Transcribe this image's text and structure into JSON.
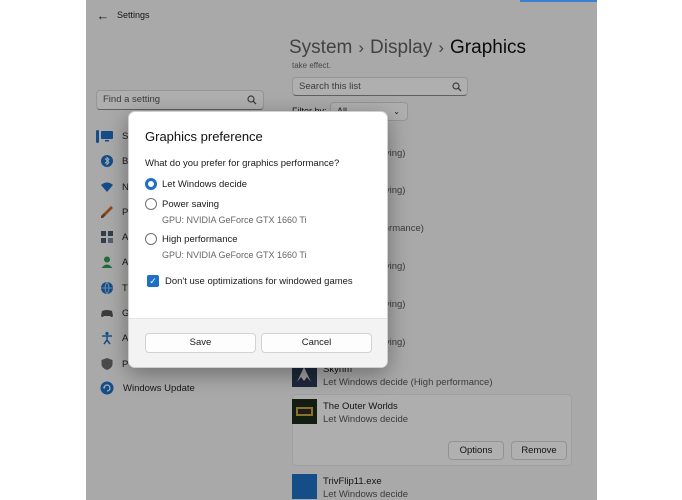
{
  "window": {
    "app_title": "Settings",
    "back_icon": "back-arrow-icon"
  },
  "sidebar": {
    "search_placeholder": "Find a setting",
    "search_icon": "search-icon",
    "items": [
      {
        "label": "Sy",
        "icon": "system-icon",
        "color": "#1f6fc4",
        "selected": true
      },
      {
        "label": "B",
        "icon": "bluetooth-icon",
        "color": "#1f6fc4"
      },
      {
        "label": "N",
        "icon": "network-icon",
        "color": "#1f6fc4"
      },
      {
        "label": "P",
        "icon": "personalization-brush-icon",
        "color": "#c96a2a"
      },
      {
        "label": "A",
        "icon": "apps-icon",
        "color": "#4b5a6b"
      },
      {
        "label": "A",
        "icon": "accounts-person-icon",
        "color": "#2e9a5a"
      },
      {
        "label": "Ti",
        "icon": "time-language-globe-icon",
        "color": "#1f6fc4"
      },
      {
        "label": "G",
        "icon": "gaming-controller-icon",
        "color": "#555555"
      },
      {
        "label": "A",
        "icon": "accessibility-icon",
        "color": "#1f6fc4"
      },
      {
        "label": "P",
        "icon": "privacy-shield-icon",
        "color": "#6b6b6b"
      }
    ],
    "windows_update": {
      "label": "Windows Update",
      "icon": "windows-update-icon"
    }
  },
  "breadcrumb": {
    "items": [
      "System",
      "Display"
    ],
    "current": "Graphics",
    "separator": "›"
  },
  "list": {
    "partial_text": "take effect.",
    "search_placeholder": "Search this list",
    "filter_label": "Filter by:",
    "filter_value": "All",
    "partial_statuses": [
      "cide (Power saving)",
      "cide (Power saving)",
      "cide (High performance)",
      "cide (Power saving)",
      "cide (Power saving)",
      "cide (Power saving)"
    ],
    "apps": [
      {
        "name": "Skyrim",
        "status": "Let Windows decide (High performance)",
        "icon": "skyrim-app-icon"
      },
      {
        "name": "The Outer Worlds",
        "status": "Let Windows decide",
        "icon": "outer-worlds-app-icon",
        "expanded": true
      },
      {
        "name": "TrivFlip11.exe",
        "status": "Let Windows decide",
        "icon": "trivflip-app-icon"
      }
    ],
    "options_label": "Options",
    "remove_label": "Remove"
  },
  "dialog": {
    "title": "Graphics preference",
    "question": "What do you prefer for graphics performance?",
    "options": [
      {
        "label": "Let Windows decide",
        "sub": "",
        "checked": true
      },
      {
        "label": "Power saving",
        "sub": "GPU: NVIDIA GeForce GTX 1660 Ti",
        "checked": false
      },
      {
        "label": "High performance",
        "sub": "GPU: NVIDIA GeForce GTX 1660 Ti",
        "checked": false
      }
    ],
    "checkbox_label": "Don't use optimizations for windowed games",
    "checkbox_checked": true,
    "save_label": "Save",
    "cancel_label": "Cancel"
  },
  "colors": {
    "accent": "#1f6fc4",
    "window_bg": "#f3f3f3"
  }
}
